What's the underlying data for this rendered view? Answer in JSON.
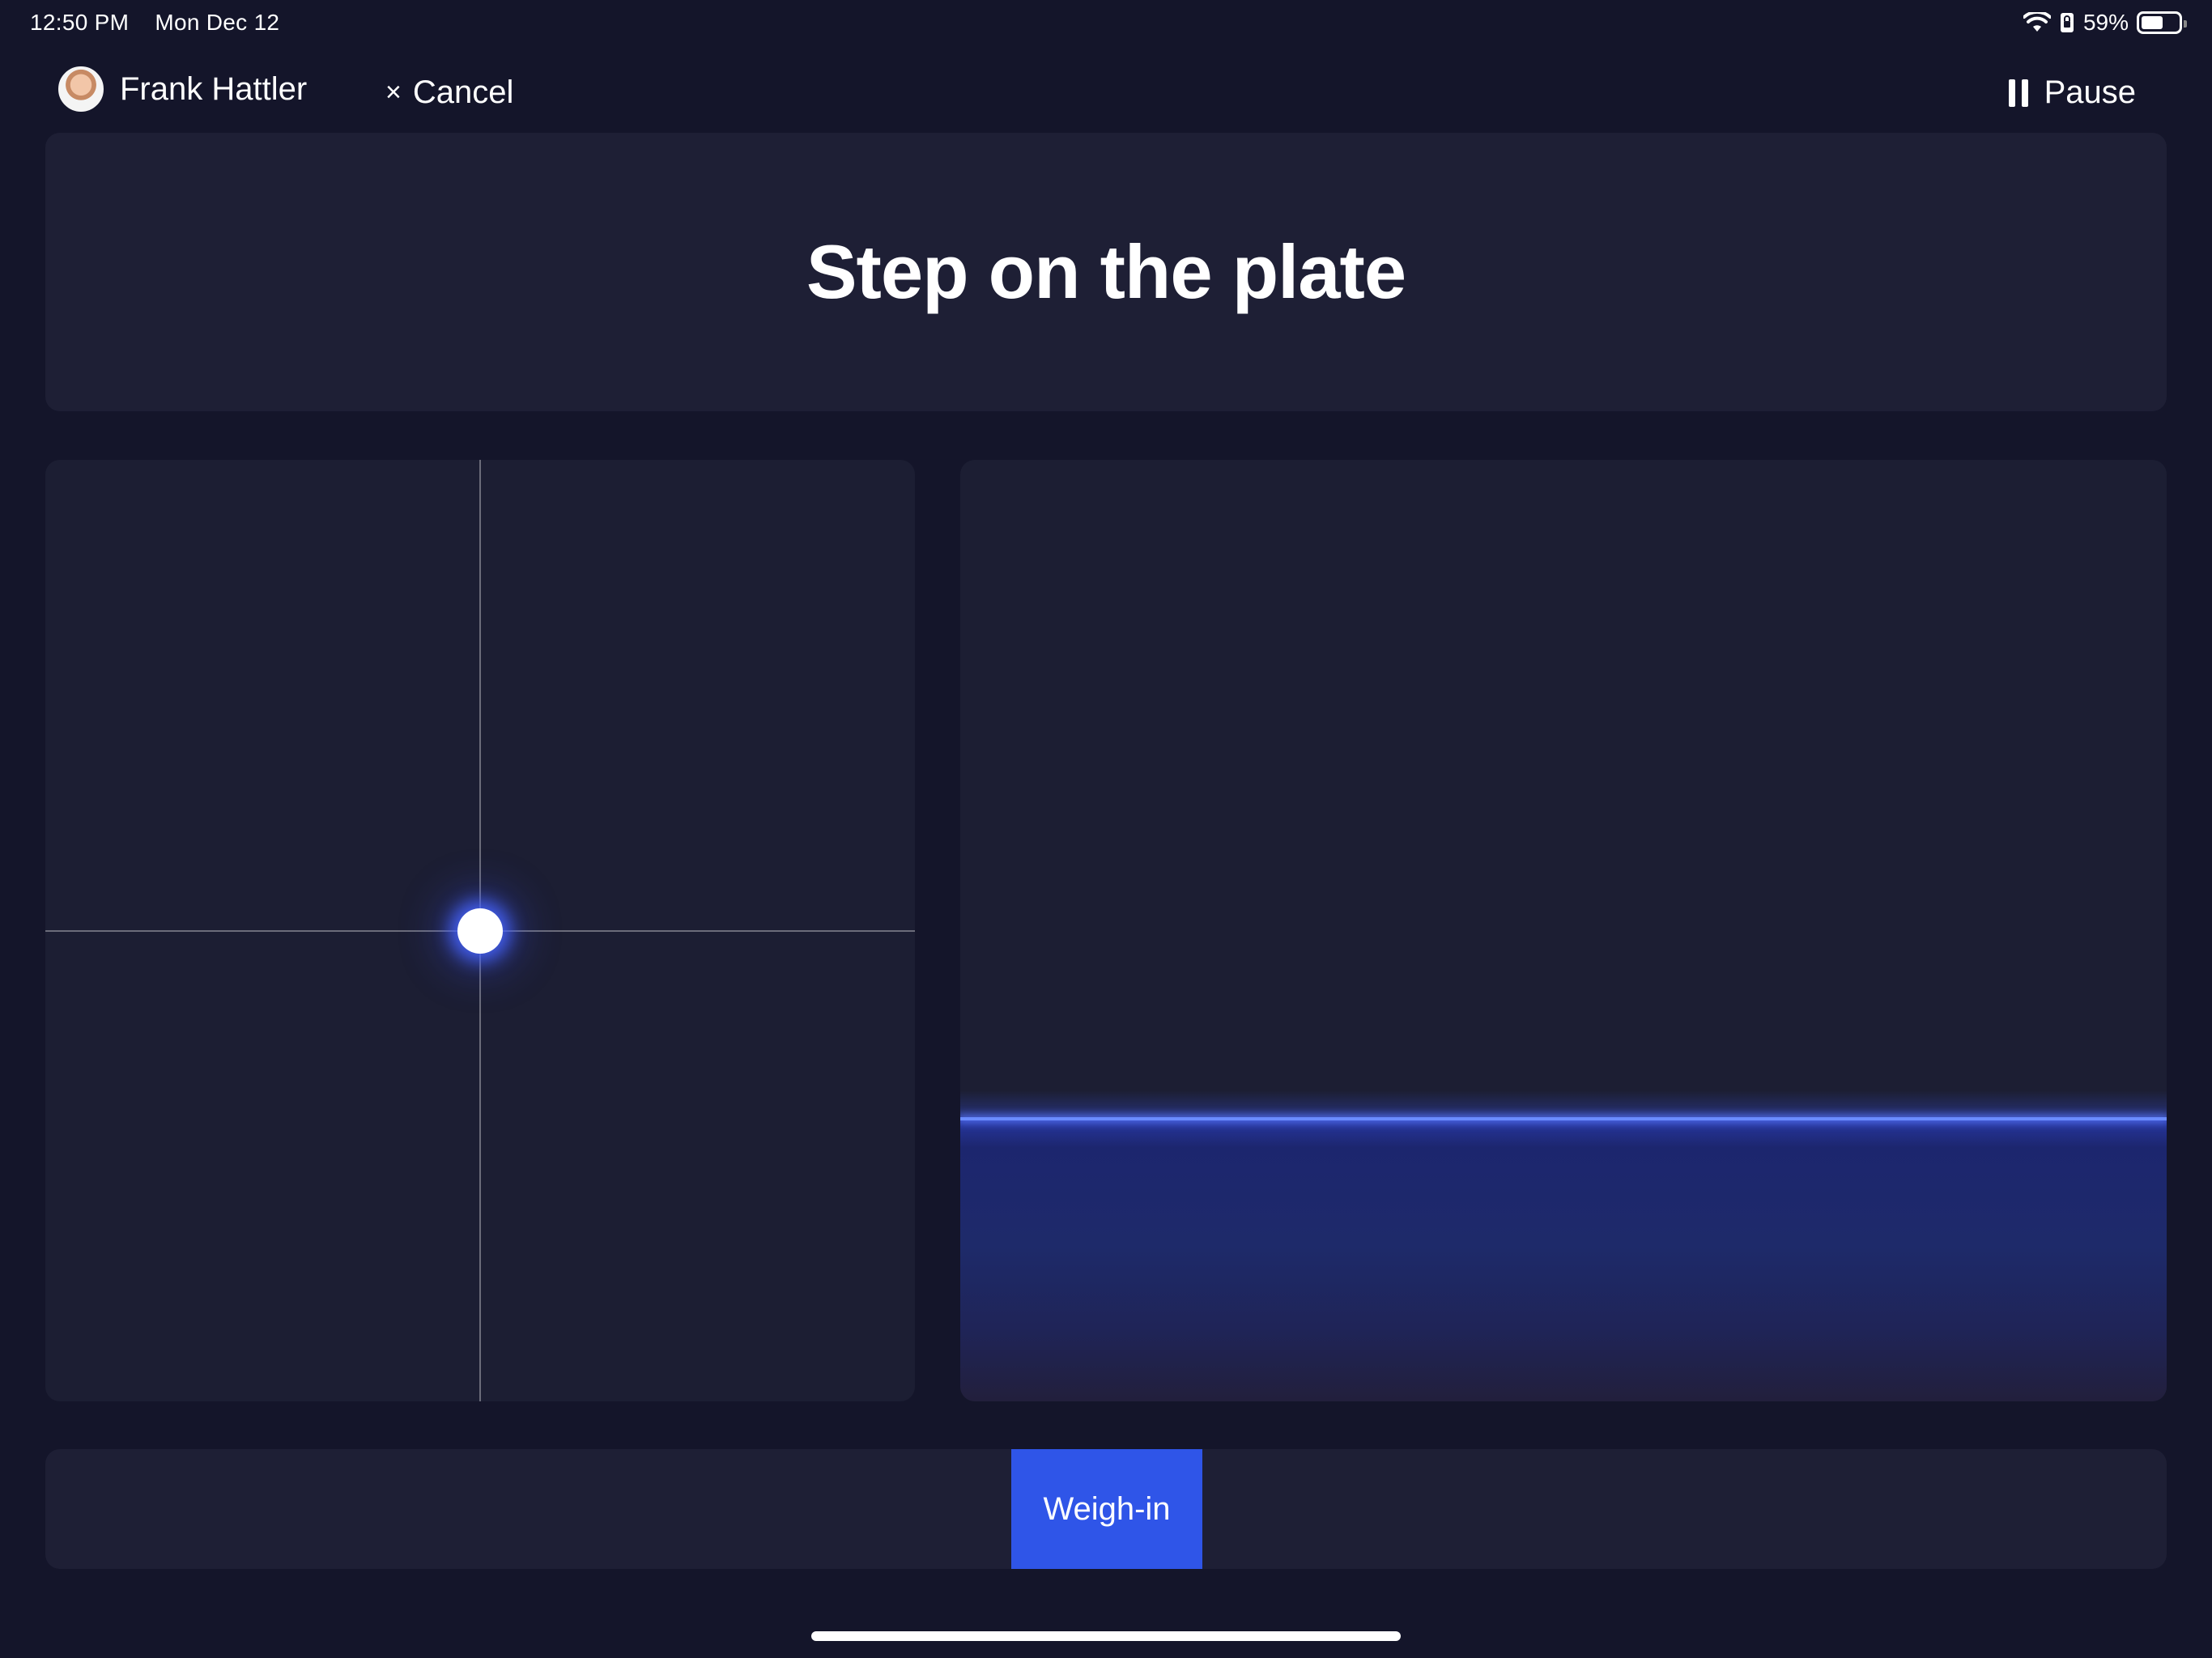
{
  "status_bar": {
    "time": "12:50 PM",
    "date": "Mon Dec 12",
    "battery_percent": "59%",
    "battery_level": 0.59,
    "icons": [
      "wifi-icon",
      "orientation-lock-icon",
      "battery-icon"
    ]
  },
  "header": {
    "user_name": "Frank Hattler",
    "cancel_icon": "×",
    "cancel_label": "Cancel",
    "pause_label": "Pause"
  },
  "title": "Step on the plate",
  "balance": {
    "position_x": 0,
    "position_y": 0
  },
  "weight": {
    "level_fraction": 0.3
  },
  "actions": {
    "weigh_in_label": "Weigh-in"
  },
  "colors": {
    "background": "#14152a",
    "panel": "#1e1f35",
    "accent": "#2f55e8",
    "line": "#6b8cff"
  }
}
